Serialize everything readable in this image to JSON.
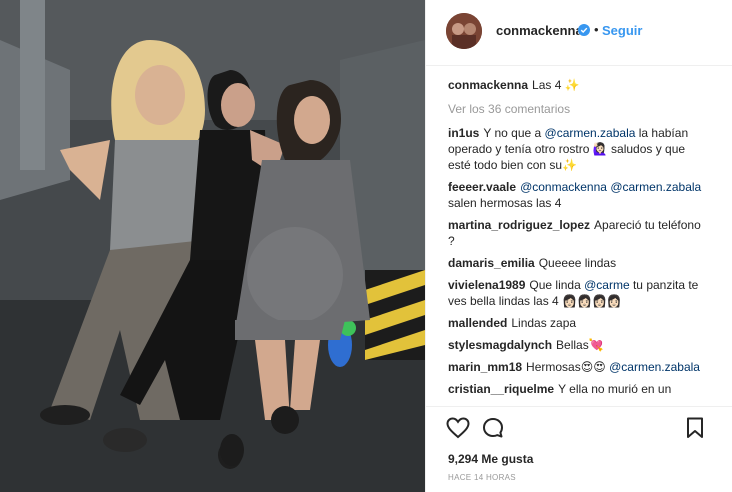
{
  "post": {
    "username": "conmackenna",
    "follow_label": "Seguir",
    "separator": "•",
    "caption": {
      "user": "conmackenna",
      "text": "Las 4 ✨"
    },
    "view_all": "Ver los 36 comentarios",
    "likes": "9,294 Me gusta",
    "time": "HACE 14 HORAS"
  },
  "comments": [
    {
      "user": "in1us",
      "parts": [
        {
          "t": "Y no que a "
        },
        {
          "m": "@carmen.zabala"
        },
        {
          "t": " la habían operado y tenía otro rostro 🙋🏻‍♀️ saludos y que esté todo bien con su✨"
        }
      ]
    },
    {
      "user": "feeeer.vaale",
      "parts": [
        {
          "m": "@conmackenna"
        },
        {
          "t": " "
        },
        {
          "m": "@carmen.zabala"
        },
        {
          "t": " salen hermosas las 4"
        }
      ]
    },
    {
      "user": "martina_rodriguez_lopez",
      "parts": [
        {
          "t": "Apareció tu teléfono ?"
        }
      ]
    },
    {
      "user": "damaris_emilia",
      "parts": [
        {
          "t": "Queeee lindas"
        }
      ]
    },
    {
      "user": "vivielena1989",
      "parts": [
        {
          "t": "Que linda "
        },
        {
          "m": "@carme"
        },
        {
          "t": " tu panzita te ves bella lindas las 4 👩🏻👩🏻👩🏻👩🏻"
        }
      ]
    },
    {
      "user": "mallended",
      "parts": [
        {
          "t": "Lindas zapa"
        }
      ]
    },
    {
      "user": "stylesmagdalynch",
      "parts": [
        {
          "t": "Bellas💘"
        }
      ]
    },
    {
      "user": "marin_mm18",
      "parts": [
        {
          "t": "Hermosas😍😍 "
        },
        {
          "m": "@carmen.zabala"
        }
      ]
    },
    {
      "user": "cristian__riquelme",
      "parts": [
        {
          "t": "Y ella no murió en un"
        }
      ]
    }
  ],
  "colors": {
    "follow": "#3897f0",
    "mention": "#003569",
    "muted": "#999999",
    "verified": "#3897f0"
  },
  "icons": [
    "heart-icon",
    "comment-icon",
    "bookmark-icon",
    "verified-badge-icon"
  ]
}
